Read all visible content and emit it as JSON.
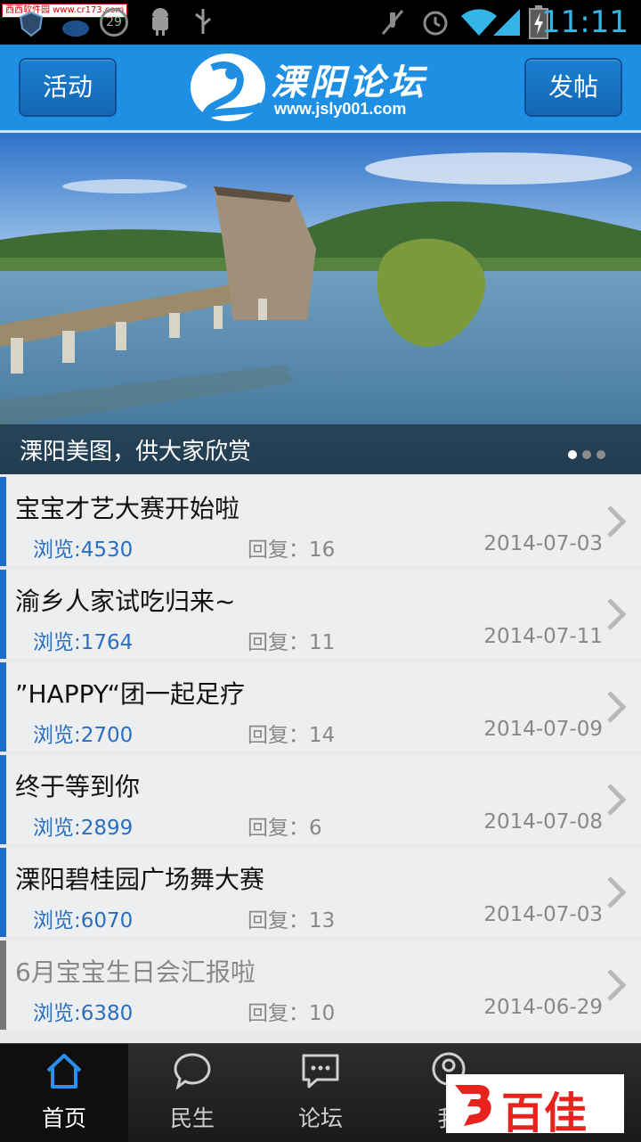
{
  "status_bar": {
    "watermark": "西西软件园 www.cr173.com",
    "badge_number": "29",
    "time": "11:11",
    "icons": [
      "shield-icon",
      "android-icon",
      "usb-icon",
      "mute-icon",
      "alarm-icon",
      "wifi-icon",
      "signal-icon",
      "battery-charging-icon"
    ]
  },
  "header": {
    "left_button": "活动",
    "right_button": "发帖",
    "logo_title": "溧阳论坛",
    "logo_url": "www.jsly001.com",
    "bg_color": "#1e8fe2"
  },
  "banner": {
    "caption": "溧阳美图，供大家欣赏",
    "page_count": 3,
    "active_page": 1
  },
  "threads": [
    {
      "title": "宝宝才艺大赛开始啦",
      "views": "浏览:4530",
      "replies": "回复：16",
      "date": "2014-07-03"
    },
    {
      "title": "渝乡人家试吃归来~",
      "views": "浏览:1764",
      "replies": "回复：11",
      "date": "2014-07-11"
    },
    {
      "title": "”HAPPY“团一起足疗",
      "views": "浏览:2700",
      "replies": "回复：14",
      "date": "2014-07-09"
    },
    {
      "title": "终于等到你",
      "views": "浏览:2899",
      "replies": "回复：6",
      "date": "2014-07-08"
    },
    {
      "title": "溧阳碧桂园广场舞大赛",
      "views": "浏览:6070",
      "replies": "回复：13",
      "date": "2014-07-03"
    },
    {
      "title": "6月宝宝生日会汇报啦",
      "views": "浏览:6380",
      "replies": "回复：10",
      "date": "2014-06-29"
    }
  ],
  "tabs": [
    {
      "label": "首页",
      "icon": "home-icon",
      "active": true
    },
    {
      "label": "民生",
      "icon": "chat-bubble-icon",
      "active": false
    },
    {
      "label": "论坛",
      "icon": "forum-icon",
      "active": false
    },
    {
      "label": "我",
      "icon": "user-icon",
      "active": false
    },
    {
      "label": "",
      "icon": "more-icon",
      "active": false
    }
  ],
  "overlay_brand": "百佳"
}
